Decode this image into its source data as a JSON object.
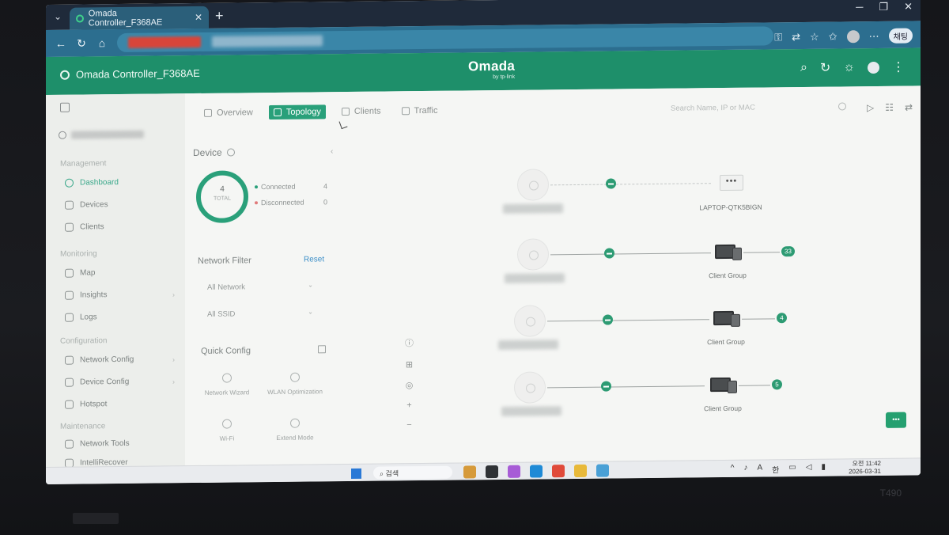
{
  "browser": {
    "tab_title": "Omada Controller_F368AE",
    "new_tab": "+",
    "profile_badge": "채팅"
  },
  "app": {
    "site_title": "Omada Controller_F368AE",
    "brand": "Omada",
    "brand_sub": "by tp-link",
    "accent_color": "#1e8f6a"
  },
  "sidebar": {
    "sections": [
      {
        "label": "Management"
      },
      {
        "label": "Monitoring"
      },
      {
        "label": "Configuration"
      },
      {
        "label": "Maintenance"
      }
    ],
    "items": [
      {
        "label": "Dashboard",
        "icon": "dashboard-icon"
      },
      {
        "label": "Devices",
        "icon": "devices-icon"
      },
      {
        "label": "Clients",
        "icon": "clients-icon"
      },
      {
        "label": "Map",
        "icon": "map-icon"
      },
      {
        "label": "Insights",
        "icon": "insights-icon"
      },
      {
        "label": "Logs",
        "icon": "logs-icon"
      },
      {
        "label": "Network Config",
        "icon": "network-config-icon"
      },
      {
        "label": "Device Config",
        "icon": "device-config-icon"
      },
      {
        "label": "Hotspot",
        "icon": "hotspot-icon"
      },
      {
        "label": "Network Tools",
        "icon": "network-tools-icon"
      },
      {
        "label": "IntelliRecover",
        "icon": "intellirecover-icon"
      }
    ]
  },
  "tabs": [
    {
      "label": "Overview"
    },
    {
      "label": "Topology"
    },
    {
      "label": "Clients"
    },
    {
      "label": "Traffic"
    }
  ],
  "search": {
    "placeholder": "Search Name, IP or MAC"
  },
  "device": {
    "title": "Device",
    "total": "4",
    "total_label": "TOTAL",
    "connected_label": "Connected",
    "connected_value": "4",
    "disconnected_label": "Disconnected",
    "disconnected_value": "0"
  },
  "network_filter": {
    "title": "Network Filter",
    "reset": "Reset",
    "network_select": "All Network",
    "ssid_select": "All SSID"
  },
  "quick_config": {
    "title": "Quick Config",
    "items": [
      {
        "label": "Network Wizard"
      },
      {
        "label": "WLAN Optimization"
      },
      {
        "label": "Wi-Fi"
      },
      {
        "label": "Extend Mode"
      }
    ]
  },
  "topology": {
    "rows": [
      {
        "client_label": "LAPTOP-QTK5BIGN",
        "client_box": "•••",
        "count": ""
      },
      {
        "client_label": "Client Group",
        "count": "33"
      },
      {
        "client_label": "Client Group",
        "count": "4"
      },
      {
        "client_label": "Client Group",
        "count": "5"
      }
    ]
  },
  "taskbar": {
    "search": "검색",
    "ime": "A",
    "lang": "한",
    "time": "오전 11:42",
    "date": "2026-03-31"
  },
  "laptop_model": "T490"
}
